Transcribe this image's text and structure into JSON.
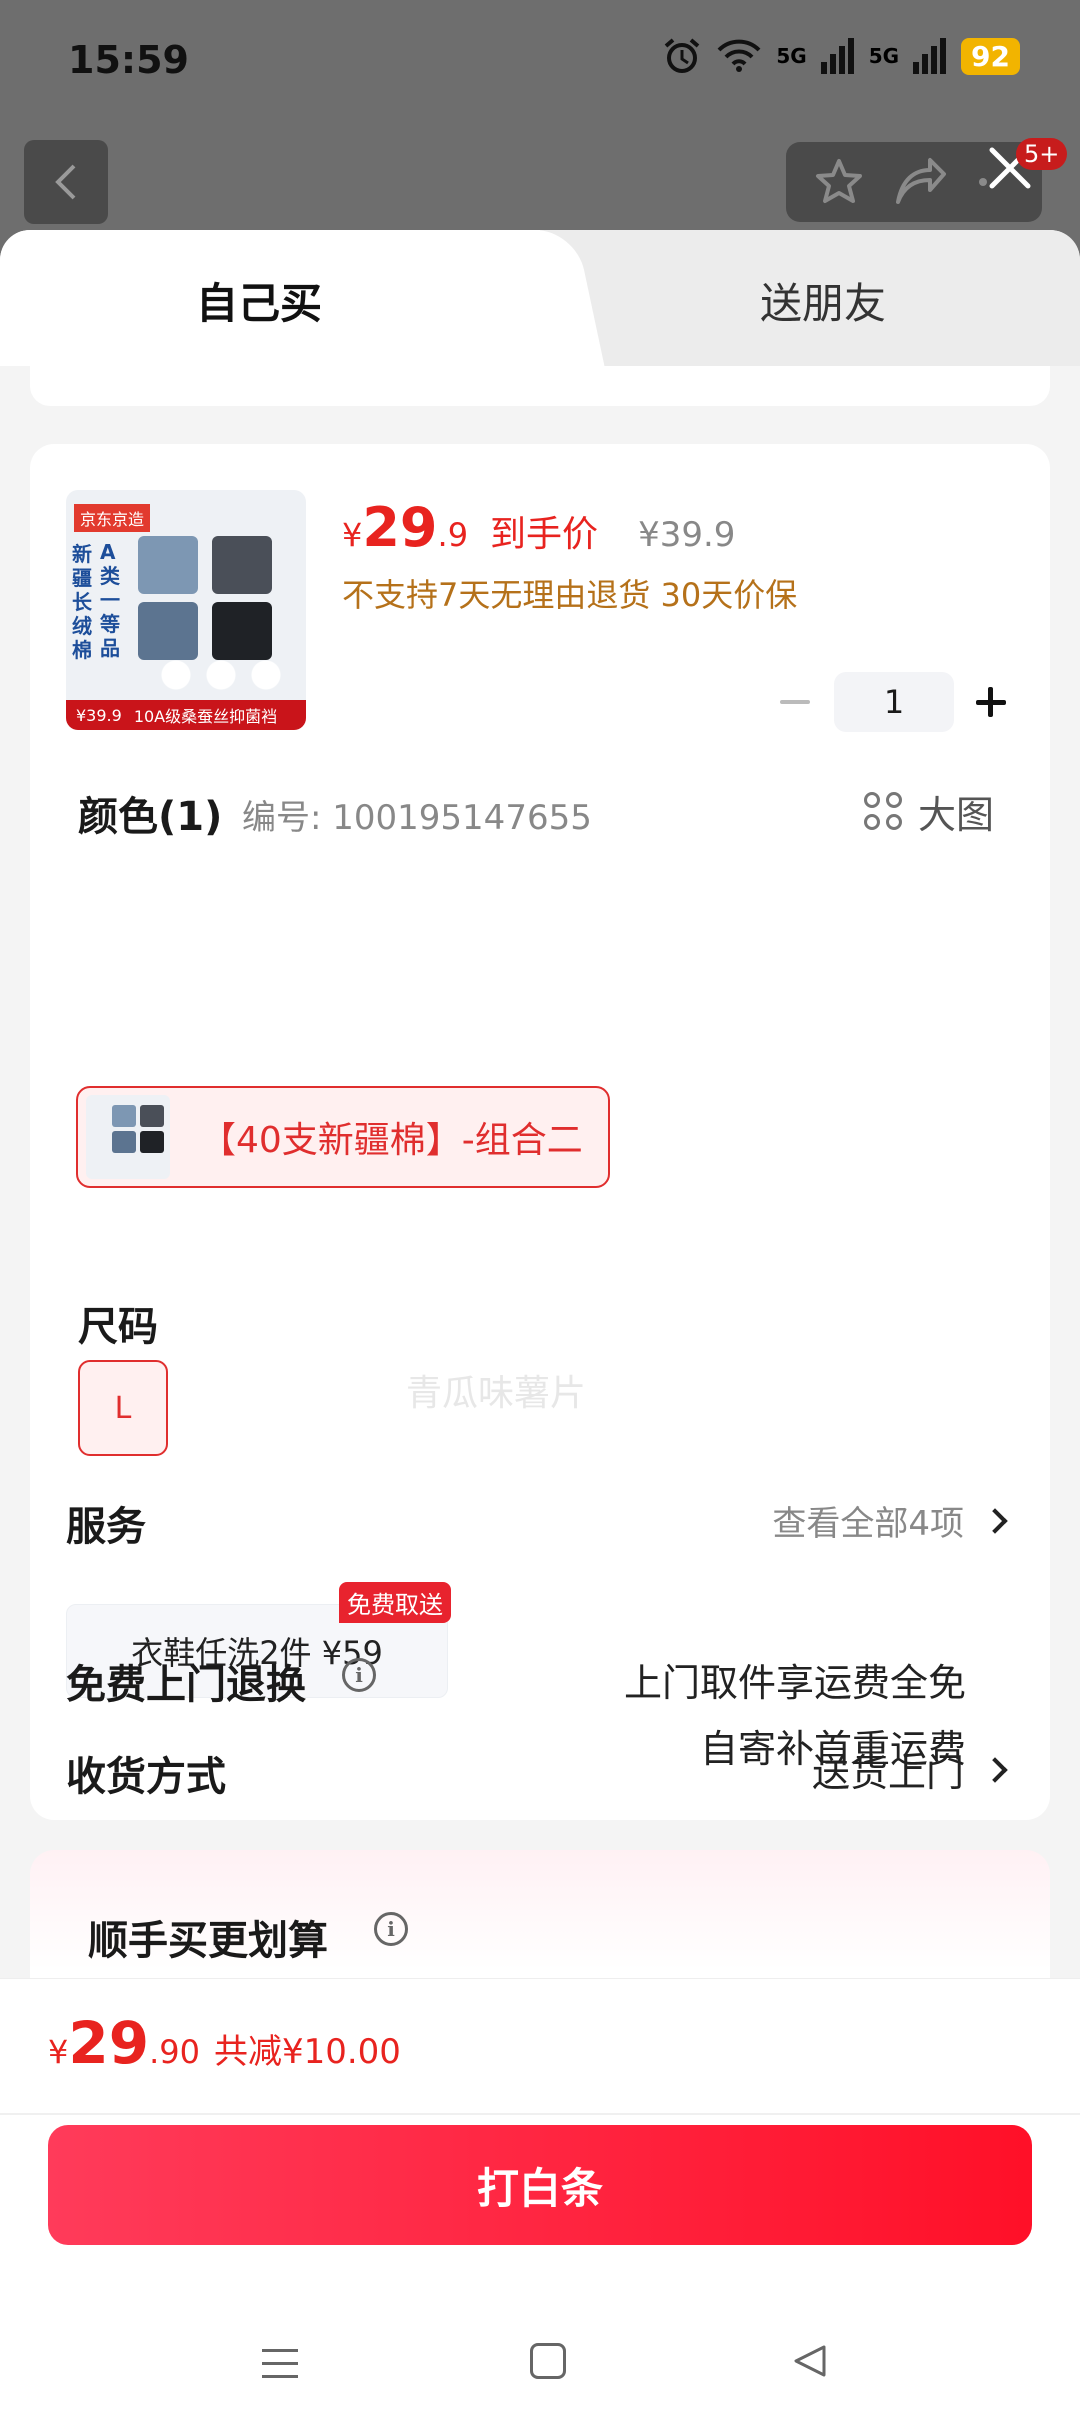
{
  "status": {
    "time": "15:59",
    "network_1": "5G",
    "network_2": "5G",
    "battery": "92"
  },
  "header": {
    "badge": "5+"
  },
  "tabs": {
    "self": "自己买",
    "friend": "送朋友"
  },
  "product": {
    "image": {
      "brand_tag": "京东京造",
      "vertical_text_1": "新疆长绒棉",
      "vertical_text_2": "A类一等品",
      "price_text": "¥39.9",
      "bar_text": "10A级桑蚕丝抑菌裆"
    },
    "price_symbol": "¥",
    "price_int": "29",
    "price_dec": ".9",
    "price_tag": "到手价",
    "old_price": "¥39.9",
    "notice": "不支持7天无理由退货  30天价保",
    "quantity": "1"
  },
  "color": {
    "title": "颜色(1)",
    "code": "编号: 100195147655",
    "bigpic": "大图",
    "option": "【40支新疆棉】-组合二"
  },
  "size": {
    "title": "尺码",
    "option": "L",
    "watermark": "青瓜味薯片"
  },
  "service": {
    "title": "服务",
    "view_all": "查看全部4项",
    "item": "衣鞋任洗2件  ¥59",
    "badge": "免费取送"
  },
  "delivery": {
    "title": "收货方式",
    "value": "送货上门"
  },
  "returns": {
    "title": "免费上门退换",
    "line1": "上门取件享运费全免",
    "line2": "自寄补首重运费"
  },
  "addon": {
    "title": "顺手买更划算"
  },
  "bottom": {
    "symbol": "¥",
    "int": "29",
    "dec": ".90",
    "save": "共减¥10.00",
    "pay": "打白条"
  },
  "colors": {
    "accent": "#e8231f",
    "button_start": "#ff3b5a",
    "button_end": "#ff1028",
    "notice": "#b5711a"
  }
}
